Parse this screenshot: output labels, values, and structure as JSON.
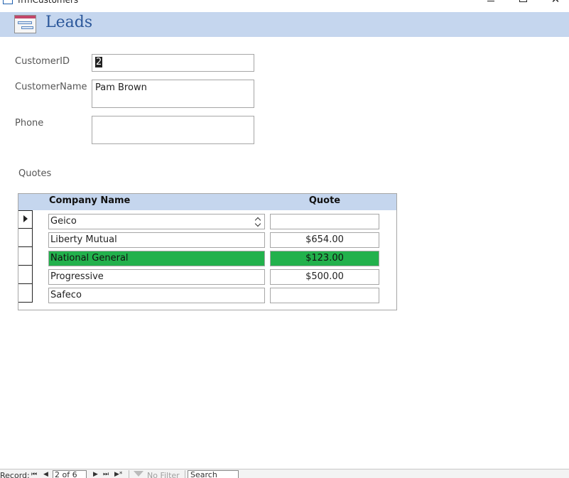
{
  "window": {
    "title": "frmCustomers",
    "close_glyph": "✕"
  },
  "header": {
    "title": "Leads",
    "icon": "form-icon"
  },
  "fields": {
    "customer_id": {
      "label": "CustomerID",
      "value": "2"
    },
    "customer_name": {
      "label": "CustomerName",
      "value": "Pam Brown"
    },
    "phone": {
      "label": "Phone",
      "value": ""
    }
  },
  "quotes": {
    "label": "Quotes",
    "columns": {
      "company": "Company Name",
      "quote": "Quote"
    },
    "rows": [
      {
        "company": "Geico",
        "quote": "",
        "current": true,
        "highlight": false
      },
      {
        "company": "Liberty Mutual",
        "quote": "$654.00",
        "current": false,
        "highlight": false
      },
      {
        "company": "National General",
        "quote": "$123.00",
        "current": false,
        "highlight": true
      },
      {
        "company": "Progressive",
        "quote": "$500.00",
        "current": false,
        "highlight": false
      },
      {
        "company": "Safeco",
        "quote": "",
        "current": false,
        "highlight": false
      }
    ],
    "highlight_color": "#22b14c"
  },
  "navigation": {
    "record_label": "Record:",
    "position": "2 of 6",
    "first": "⏮",
    "prev": "◀",
    "next": "▶",
    "last": "⏭",
    "new": "▶*",
    "filter_label": "No Filter",
    "search_placeholder": "Search"
  }
}
